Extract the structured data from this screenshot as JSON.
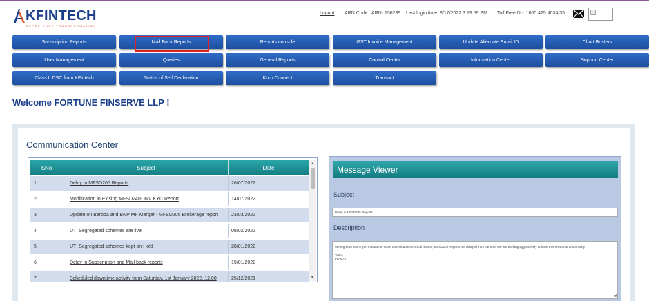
{
  "header": {
    "logo_text": "KFINTECH",
    "logo_tagline": "EXPERIENCE TRANSFORMATION",
    "logout": "Logout",
    "arn": "ARN Code : ARN- 156289",
    "last_login": "Last login time: 8/17/2022 3:19:59 PM",
    "toll_free": "Toll Free No: 1800 425 4034/35",
    "mail_icon": "envelope-icon"
  },
  "nav": {
    "row1": [
      "Subscription Reports",
      "Mail Back Reports",
      "Reports console",
      "GST Invoice Management",
      "Update Alternate Email ID",
      "Chart Busters"
    ],
    "row2": [
      "User Management",
      "Queries",
      "General Reports",
      "Control Center",
      "Information Center",
      "Support Center"
    ],
    "row3": [
      "Class II DSC from KFintech",
      "Status of Self Declaration",
      "Korp Connect",
      "Transact"
    ],
    "active": "Mail Back Reports"
  },
  "welcome": "Welcome FORTUNE FINSERVE LLP !",
  "communication": {
    "title": "Communication Center",
    "columns": [
      "SNo",
      "Subject",
      "Date"
    ],
    "rows": [
      {
        "sno": "1",
        "subject": "Delay in MFSD205 Reports",
        "date": "26/07/2022"
      },
      {
        "sno": "2",
        "subject": "Modification in Exising MFSD240- INV KYC Report",
        "date": "14/07/2022"
      },
      {
        "sno": "3",
        "subject": "Update on Baroda and BNP MF Merger - MFSD205 Brokerage report",
        "date": "23/03/2022"
      },
      {
        "sno": "4",
        "subject": "UTI Segregated schemes are live",
        "date": "08/02/2022"
      },
      {
        "sno": "5",
        "subject": "UTI Segregated schemes kept on Hold",
        "date": "28/01/2022"
      },
      {
        "sno": "6",
        "subject": "Delay in Subscription and Mail back reports",
        "date": "19/01/2022"
      },
      {
        "sno": "7",
        "subject": "Scheduled downtime activity from Saturday, 1st January 2022, 12.00",
        "date": "25/12/2021"
      }
    ]
  },
  "viewer": {
    "title": "Message Viewer",
    "subject_label": "Subject",
    "subject_value": "Delay in MFSD205 Reports",
    "description_label": "Description",
    "description_lines": [
      "We regret to inform you that due to some unavoidable technical reason, MFSD205 Reports are delayed from our end. We are working aggressively to have them restored to normalcy.",
      "",
      "Team,",
      "Kfintech"
    ]
  }
}
